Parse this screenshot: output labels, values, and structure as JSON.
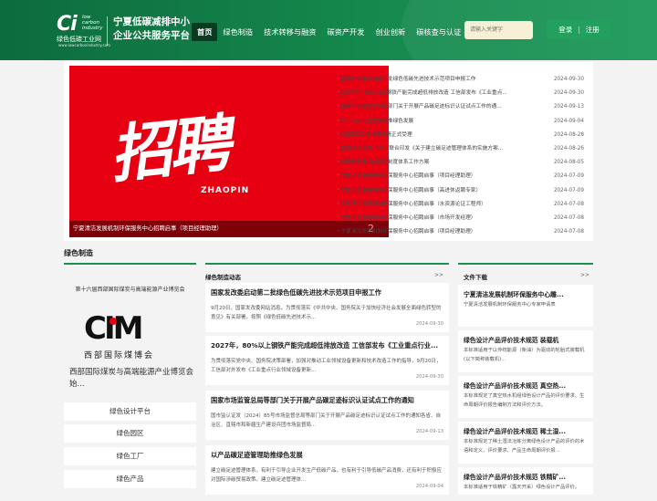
{
  "header": {
    "logo_mark": "Ci",
    "logo_tag": [
      "low",
      "carbon",
      "industry"
    ],
    "logo_cn": "绿色低碳工业网",
    "logo_url": "www.lowcarbonindustry.com",
    "site_title": "宁夏低碳减排中小企业公共服务平台",
    "nav": [
      "首页",
      "绿色制造",
      "技术转移与融资",
      "碳资产开发",
      "创业创新",
      "碳核查与认证"
    ],
    "search_placeholder": "请输入关键字",
    "login": "登录",
    "separator": "|",
    "register": "注册"
  },
  "banner": {
    "big_text": "招聘",
    "sub_text": "ZHAOPIN",
    "caption": "宁夏清洁发展机制环保服务中心招聘启事（项目经理助理）",
    "page_number": "2"
  },
  "news": [
    {
      "title": "国家发改委启动第二批绿色低碳先进技术示范项目申报工作",
      "date": "2024-09-30"
    },
    {
      "title": "2027年，80%以上钢铁产能完成超低排放改造 工信部发布《工业重点...",
      "date": "2024-09-30"
    },
    {
      "title": "国家市场监督总局等部门关于开展产品碳足迹标识认证试点工作的通...",
      "date": "2024-09-13"
    },
    {
      "title": "以产品碳足迹管理助推绿色发展",
      "date": "2024-09-04"
    },
    {
      "title": "CCER项目减排量申请正式受理",
      "date": "2024-08-28"
    },
    {
      "title": "生态环境部等15部门联合印发《关于建立碳足迹管理体系的实施方案...",
      "date": "2024-08-26"
    },
    {
      "title": "加快构建碳排放双控制度体系工作方案",
      "date": "2024-08-05"
    },
    {
      "title": "宁夏清洁发展机制环保服务中心招聘启事（项目经理助理）",
      "date": "2024-07-09"
    },
    {
      "title": "宁夏清洁发展机制环保服务中心招聘启事（高进休返聘专家）",
      "date": "2024-07-09"
    },
    {
      "title": "宁夏清洁发展机制环保服务中心招聘启事（水资源论证工程师）",
      "date": "2024-07-08"
    },
    {
      "title": "宁夏清洁发展机制环保服务中心招聘启事（市场开发经理）",
      "date": "2024-07-08"
    },
    {
      "title": "宁夏清洁发展机制环保服务中心招聘启事（项目经理助理）",
      "date": "2024-07-08"
    }
  ],
  "left": {
    "section_title": "绿色制造",
    "promo_title": "第十六届西部国际煤炭与高端能源产业博览会",
    "cim_logo": "CIM",
    "cim_cn": "西部国际煤博会",
    "desc": "西部国际煤炭与高端能源产业博览会始...",
    "buttons": [
      "绿色设计平台",
      "绿色园区",
      "绿色工厂",
      "绿色产品"
    ]
  },
  "middle": {
    "heading": "绿色制造动态",
    "more": ">>",
    "articles": [
      {
        "title": "国家发改委启动第二批绿色低碳先进技术示范项目申报工作",
        "body": "9月20日，国家发改委网站消息，为贯彻落实《中共中央、国务院关于加快经济社会发展全面绿色转型的意见》有关部署，按照《绿色低碳先进技术示...",
        "date": "2024-09-30"
      },
      {
        "title": "2027年，80%以上钢铁产能完成超低排放改造 工信部发布《工业重点行业...",
        "body": "为贯彻落实党中央、国务院决策部署，加强对推动工业领域设备更新和技术改造工作的指导，9月20日，工信部对外发布《工业重点行业领域设备更新...",
        "date": "2024-09-30"
      },
      {
        "title": "国家市场监管总局等部门关于开展产品碳足迹标识认证试点工作的通知",
        "body": "国市监认证发〔2024〕85号市场监督总局等部门关于开展产品碳足迹标识认证试点工作的通知各省、自治区、直辖市和新疆生产建设兵团市场监督局...",
        "date": "2024-09-13"
      },
      {
        "title": "以产品碳足迹管理助推绿色发展",
        "body": "建立碳足迹管理体系，有利于引导企业开发生产低碳产品，也有利于引导低碳产品消费，还有利于积极应对国际涉碳贸易政策。建立碳足迹管理体...",
        "date": "2024-09-04"
      }
    ]
  },
  "right": {
    "heading": "文件下载",
    "more": ">>",
    "docs": [
      {
        "title": "宁夏清洁发展机制环保服务中心雕...",
        "body": "宁夏清洁发展机制环保服务中心专家申请表"
      },
      {
        "title": "绿色设计产品评价技术规范 装载机",
        "body": "本标准适用于以传统能源（柴油）为驱动的轮胎式装载机(以下简称装载机)..."
      },
      {
        "title": "绿色设计产品评价技术规范 真空热...",
        "body": "本标准规定了真空热水机组绿色设计产品的评价要求、生命周期评价报告编制方法和评价方法。"
      },
      {
        "title": "绿色设计产品评价技术规范 稀土湿...",
        "body": "本标准规定了稀土湿法冶炼分离绿色设计产品的评价的术语和定义、评价要求、产品生命周期评价报..."
      },
      {
        "title": "绿色设计产品评价技术规范 铁精矿...",
        "body": "本标准适用于铁精矿（露天开采）绿色设计产品评价。"
      }
    ]
  }
}
